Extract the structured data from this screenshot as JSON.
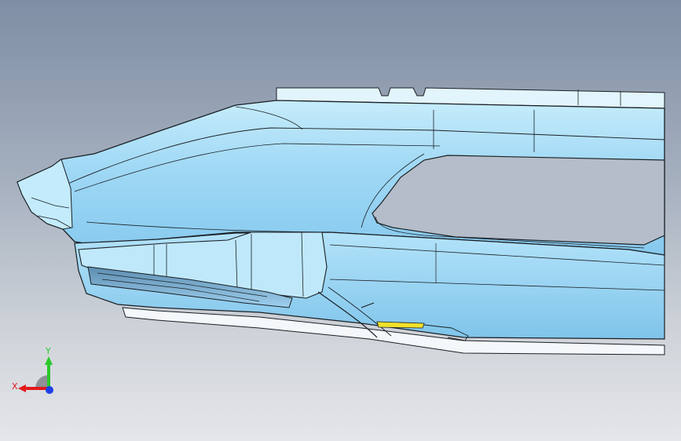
{
  "viewport": {
    "background_top": "#7f8ea4",
    "background_bottom": "#e4e6e9",
    "part_color": "#a9ddf8",
    "part_shade": "#8ccdf0",
    "edge_color": "#1a1f24",
    "hole_color": "#b7c0cb"
  },
  "model": {
    "name": "bumper-lower-part-model"
  },
  "axis_triad": {
    "x_label": "X",
    "y_label": "Y",
    "x_color": "#e2191b",
    "y_color": "#2ac92a",
    "z_color": "#1f3fe6"
  }
}
